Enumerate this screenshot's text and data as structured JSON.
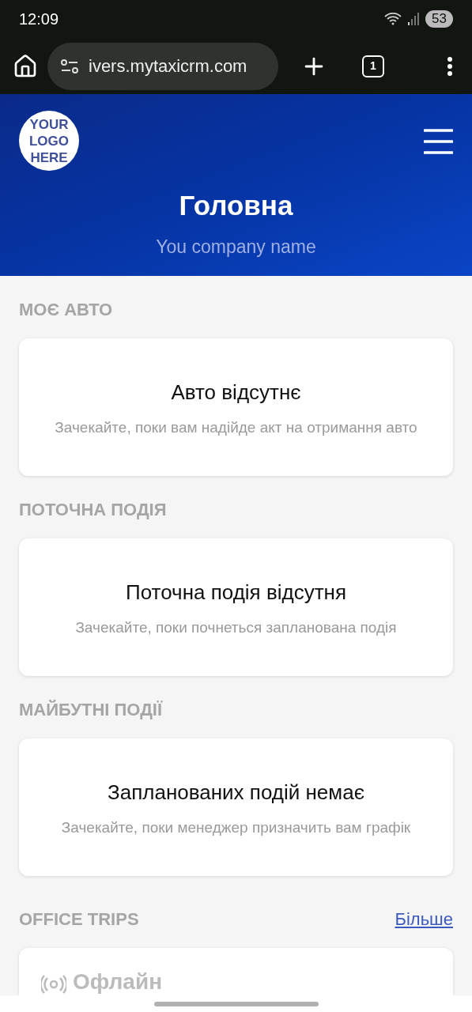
{
  "status_bar": {
    "time": "12:09",
    "battery": "53"
  },
  "browser": {
    "url": "ivers.mytaxicrm.com",
    "tab_count": "1"
  },
  "header": {
    "logo": [
      "YOUR",
      "LOGO",
      "HERE"
    ],
    "title": "Головна",
    "subtitle": "You company name"
  },
  "sections": [
    {
      "title": "МОЄ АВТО",
      "heading": "Авто відсутнє",
      "message": "Зачекайте, поки вам надійде акт на отримання авто"
    },
    {
      "title": "ПОТОЧНА ПОДІЯ",
      "heading": "Поточна подія відсутня",
      "message": "Зачекайте, поки почнеться запланована подія"
    },
    {
      "title": "МАЙБУТНІ ПОДІЇ",
      "heading": "Запланованих подій немає",
      "message": "Зачекайте, поки менеджер призначить вам графік"
    }
  ],
  "office_trips": {
    "title": "OFFICE TRIPS",
    "more_link": "Більше",
    "status": "Офлайн"
  }
}
